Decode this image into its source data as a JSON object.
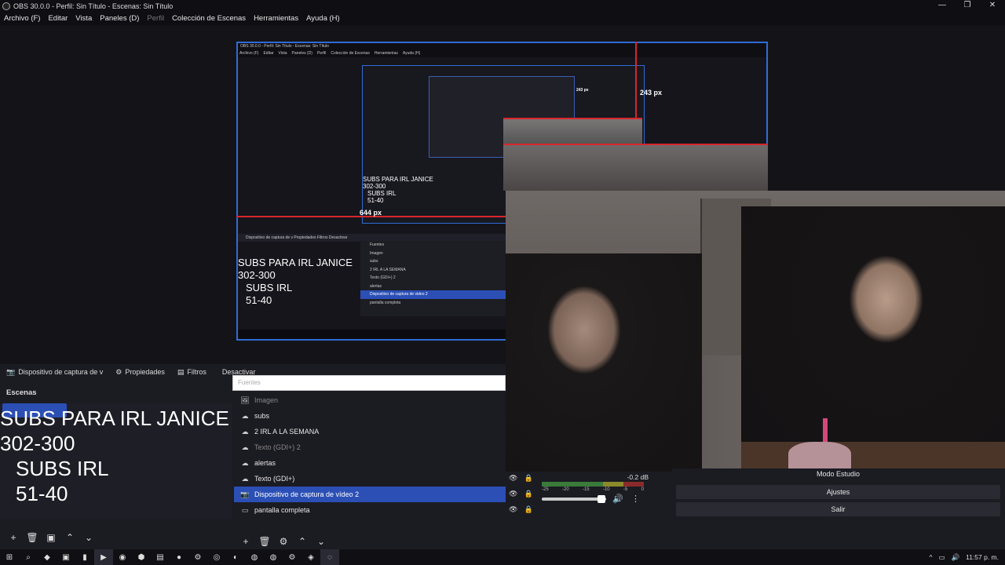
{
  "window": {
    "title": "OBS 30.0.0 - Perfil: Sin Título - Escenas: Sin Título",
    "minimize": "—",
    "maximize": "❐",
    "close": "✕"
  },
  "menu": [
    {
      "label": "Archivo (F)",
      "disabled": false
    },
    {
      "label": "Editar",
      "disabled": false
    },
    {
      "label": "Vista",
      "disabled": false
    },
    {
      "label": "Paneles (D)",
      "disabled": false
    },
    {
      "label": "Perfil",
      "disabled": true
    },
    {
      "label": "Colección de Escenas",
      "disabled": false
    },
    {
      "label": "Herramientas",
      "disabled": false
    },
    {
      "label": "Ayuda (H)",
      "disabled": false
    }
  ],
  "preview": {
    "nested_title": "OBS 30.0.0 - Perfil: Sin Título - Escenas: Sin Título",
    "nested_menu": [
      "Archivo (F)",
      "Editar",
      "Vista",
      "Paneles (D)",
      "Perfil",
      "Colección de Escenas",
      "Herramientas",
      "Ayuda (H)"
    ],
    "px_label_right": "243 px",
    "px_label_left": "644 px",
    "nested_inner_label": "243 px",
    "nested_text_lines": [
      "SUBS PARA IRL JANICE",
      "302-300",
      "SUBS IRL",
      "51-40"
    ],
    "nested_inner_text": [
      "SUBS PARA IRL JANICE",
      "302-300",
      "SUBS IRL",
      "51-40"
    ],
    "nested_panel": "Dispositivo de captura de v     Propiedades     Filtros     Desactivar",
    "nested_panel_scenes": "Escenas",
    "nested_sources": [
      "Fuentes",
      "Imagen",
      "subs",
      "2 IRL A LA SEMANA",
      "Texto (GDI+) 2",
      "alertas",
      "Texto (GDI+)",
      "Dispositivo de captura de video 2",
      "pantalla completa"
    ]
  },
  "docktabs": {
    "source_name": "Dispositivo de captura de v",
    "properties": "Propiedades",
    "filters": "Filtros",
    "deactivate": "Desactivar"
  },
  "scenes": {
    "header": "Escenas",
    "overlay_lines": [
      "SUBS PARA IRL JANICE",
      "302-300",
      "SUBS IRL",
      "51-40"
    ],
    "toolbar": [
      "+",
      "🗑",
      "▣",
      "⌃",
      "⌄"
    ]
  },
  "sources": {
    "filter_placeholder": "Fuentes",
    "items": [
      {
        "icon": "🖼",
        "label": "Imagen",
        "dim": true,
        "selected": false
      },
      {
        "icon": "☁",
        "label": "subs",
        "dim": false,
        "selected": false
      },
      {
        "icon": "☁",
        "label": "2 IRL A LA SEMANA",
        "dim": false,
        "selected": false
      },
      {
        "icon": "☁",
        "label": "Texto (GDI+) 2",
        "dim": true,
        "selected": false
      },
      {
        "icon": "☁",
        "label": "alertas",
        "dim": false,
        "selected": false
      },
      {
        "icon": "☁",
        "label": "Texto (GDI+)",
        "dim": false,
        "selected": false
      },
      {
        "icon": "📷",
        "label": "Dispositivo de captura de vídeo 2",
        "dim": false,
        "selected": true
      },
      {
        "icon": "▭",
        "label": "pantalla completa",
        "dim": false,
        "selected": false
      }
    ],
    "toolbar": [
      "+",
      "🗑",
      "⚙",
      "⌃",
      "⌄"
    ]
  },
  "mixer": {
    "db": "-0.2 dB",
    "ticks": [
      "-25",
      "-20",
      "-15",
      "-10",
      "-5",
      "0"
    ],
    "level": 0.9
  },
  "controls": {
    "studio_mode": "Modo Estudio",
    "settings": "Ajustes",
    "exit": "Salir"
  },
  "taskbar": {
    "time": "11:57 p. m.",
    "tray_icons": [
      "^",
      "▭",
      "🔊"
    ]
  },
  "colors": {
    "accent_blue": "#2b4fb5",
    "border_blue": "#2f6bd7",
    "guide_red": "#d8262b"
  }
}
